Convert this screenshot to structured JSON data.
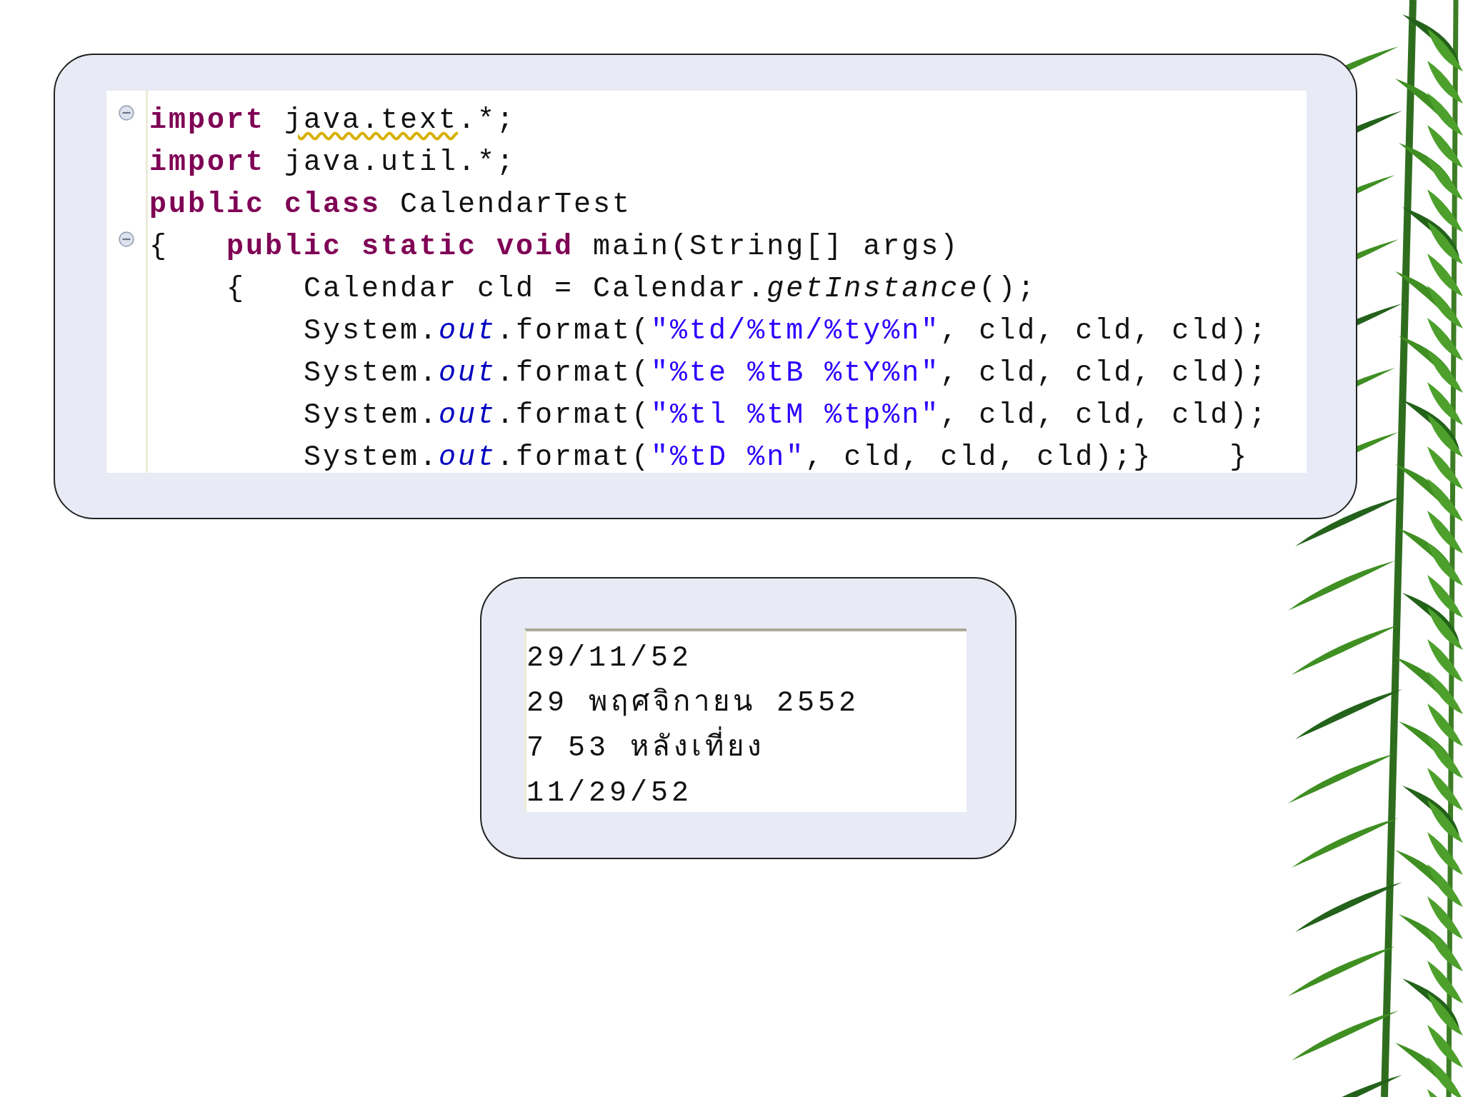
{
  "code_editor": {
    "lines": [
      {
        "fold": true,
        "tokens": [
          {
            "kind": "keyword",
            "text": "import "
          },
          {
            "kind": "warning",
            "text": "java.text"
          },
          {
            "kind": "plain",
            "text": ".*;"
          }
        ]
      },
      {
        "fold": false,
        "tokens": [
          {
            "kind": "keyword",
            "text": "import"
          },
          {
            "kind": "plain",
            "text": " java.util.*;"
          }
        ]
      },
      {
        "fold": false,
        "tokens": [
          {
            "kind": "keyword",
            "text": "public "
          },
          {
            "kind": "keyword",
            "text": "class"
          },
          {
            "kind": "plain",
            "text": " CalendarTest"
          }
        ]
      },
      {
        "fold": true,
        "tokens": [
          {
            "kind": "plain",
            "text": "{   "
          },
          {
            "kind": "keyword",
            "text": "public "
          },
          {
            "kind": "keyword",
            "text": "static "
          },
          {
            "kind": "keyword",
            "text": "void"
          },
          {
            "kind": "plain",
            "text": " main(String[] args)"
          }
        ]
      },
      {
        "fold": false,
        "tokens": [
          {
            "kind": "plain",
            "text": "    {   Calendar cld = Calendar."
          },
          {
            "kind": "method",
            "text": "getInstance"
          },
          {
            "kind": "plain",
            "text": "();"
          }
        ]
      },
      {
        "fold": false,
        "tokens": [
          {
            "kind": "plain",
            "text": "        System."
          },
          {
            "kind": "field",
            "text": "out"
          },
          {
            "kind": "plain",
            "text": ".format("
          },
          {
            "kind": "string",
            "text": "\"%td/%tm/%ty%n\""
          },
          {
            "kind": "plain",
            "text": ", cld, cld, cld);"
          }
        ]
      },
      {
        "fold": false,
        "tokens": [
          {
            "kind": "plain",
            "text": "        System."
          },
          {
            "kind": "field",
            "text": "out"
          },
          {
            "kind": "plain",
            "text": ".format("
          },
          {
            "kind": "string",
            "text": "\"%te %tB %tY%n\""
          },
          {
            "kind": "plain",
            "text": ", cld, cld, cld);"
          }
        ]
      },
      {
        "fold": false,
        "tokens": [
          {
            "kind": "plain",
            "text": "        System."
          },
          {
            "kind": "field",
            "text": "out"
          },
          {
            "kind": "plain",
            "text": ".format("
          },
          {
            "kind": "string",
            "text": "\"%tl %tM %tp%n\""
          },
          {
            "kind": "plain",
            "text": ", cld, cld, cld);"
          }
        ]
      },
      {
        "fold": false,
        "tokens": [
          {
            "kind": "plain",
            "text": "        System."
          },
          {
            "kind": "field",
            "text": "out"
          },
          {
            "kind": "plain",
            "text": ".format("
          },
          {
            "kind": "string",
            "text": "\"%tD %n\""
          },
          {
            "kind": "plain",
            "text": ", cld, cld, cld);}    }"
          }
        ]
      }
    ]
  },
  "console_output": {
    "lines": [
      "29/11/52",
      "29 พฤศจิกายน 2552",
      "7 53 หลังเที่ยง",
      "11/29/52"
    ]
  }
}
